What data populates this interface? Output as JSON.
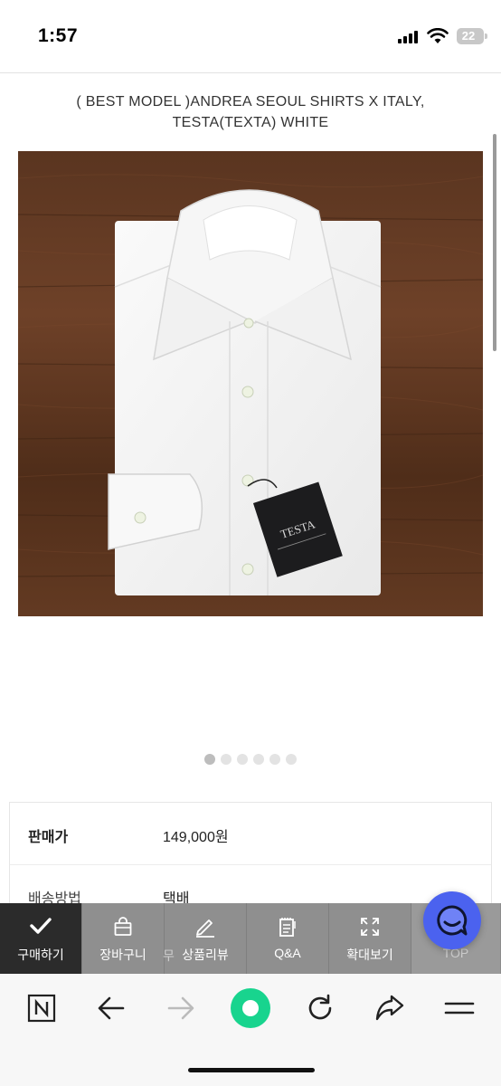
{
  "status_bar": {
    "time": "1:57",
    "battery": "22"
  },
  "product": {
    "title": "( BEST MODEL )ANDREA SEOUL SHIRTS X ITALY, TESTA(TEXTA) WHITE",
    "tag_brand": "TESTA"
  },
  "carousel": {
    "total": 6,
    "active_index": 0
  },
  "info": {
    "rows": [
      {
        "label": "판매가",
        "value": "149,000원"
      },
      {
        "label": "배송방법",
        "value": "택배"
      }
    ],
    "partial_label": "무"
  },
  "action_bar": {
    "items": [
      {
        "label": "구매하기",
        "icon": "check-icon"
      },
      {
        "label": "장바구니",
        "icon": "bag-icon"
      },
      {
        "label": "상품리뷰",
        "icon": "pencil-icon"
      },
      {
        "label": "Q&A",
        "icon": "notepad-icon"
      },
      {
        "label": "확대보기",
        "icon": "expand-icon"
      },
      {
        "label": "TOP",
        "icon": "top-icon"
      }
    ]
  },
  "colors": {
    "accent": "#4b62ef",
    "green": "#18d48e",
    "bar": "#8f8f8f",
    "active": "#2b2b2b"
  },
  "browser_bar": {
    "icons": [
      "naver-icon",
      "back-icon",
      "forward-icon",
      "green-dot-icon",
      "reload-icon",
      "share-icon",
      "menu-icon"
    ]
  }
}
